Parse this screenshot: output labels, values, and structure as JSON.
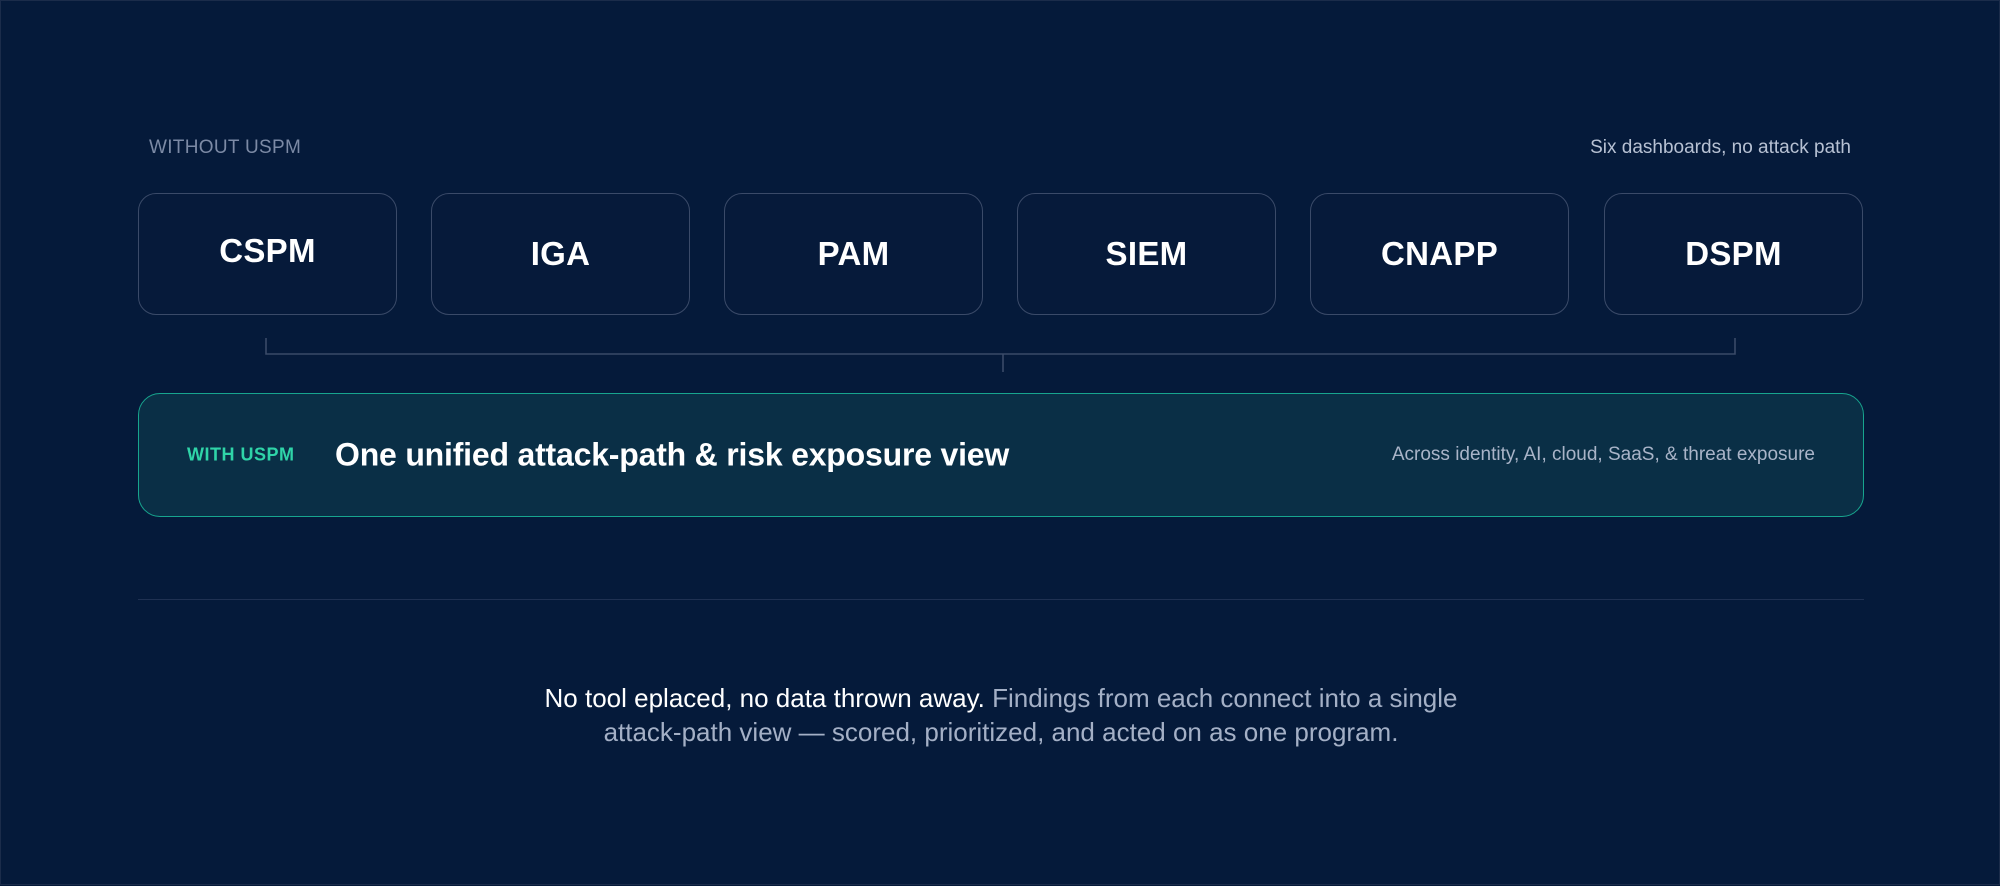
{
  "without": {
    "label": "WITHOUT USPM",
    "note": "Six dashboards, no attack path"
  },
  "tools": [
    {
      "label": "CSPM"
    },
    {
      "label": "IGA"
    },
    {
      "label": "PAM"
    },
    {
      "label": "SIEM"
    },
    {
      "label": "CNAPP"
    },
    {
      "label": "DSPM"
    }
  ],
  "with": {
    "label": "WITH USPM",
    "title": "One unified attack-path & risk exposure view",
    "scope": "Across identity, AI, cloud, SaaS, & threat exposure"
  },
  "footer": {
    "strong": "No tool eplaced, no data thrown away.",
    "soft_1": " Findings from each connect into a single",
    "soft_2": "attack-path view — scored, prioritized, and acted on as one program."
  },
  "colors": {
    "background": "#051a3a",
    "tool_border": "#3a4a68",
    "accent": "#2fd4a8",
    "unified_border": "#17a58e",
    "unified_fill": "#0a2f46"
  }
}
